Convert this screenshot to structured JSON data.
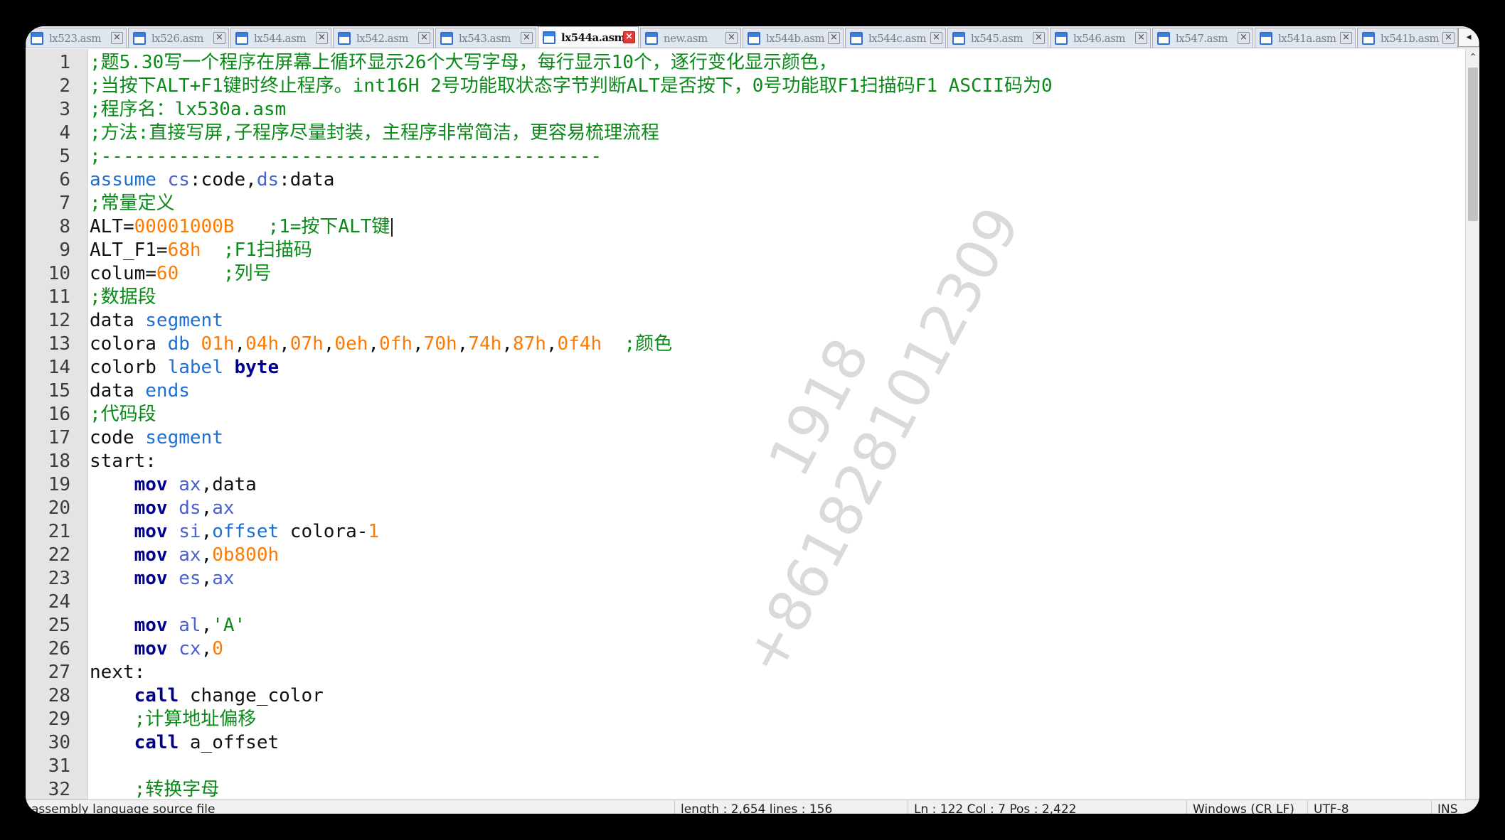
{
  "tabs": [
    {
      "label": "lx523.asm"
    },
    {
      "label": "lx526.asm"
    },
    {
      "label": "lx544.asm"
    },
    {
      "label": "lx542.asm"
    },
    {
      "label": "lx543.asm"
    },
    {
      "label": "lx544a.asm",
      "active": true
    },
    {
      "label": "new.asm"
    },
    {
      "label": "lx544b.asm"
    },
    {
      "label": "lx544c.asm"
    },
    {
      "label": "lx545.asm"
    },
    {
      "label": "lx546.asm"
    },
    {
      "label": "lx547.asm"
    },
    {
      "label": "lx541a.asm"
    },
    {
      "label": "lx541b.asm"
    }
  ],
  "tab_close_glyph": "×",
  "tab_nav_glyph": "◂",
  "code_lines": [
    {
      "n": "1",
      "tokens": [
        {
          "c": "c",
          "t": ";题5.30写一个程序在屏幕上循环显示26个大写字母，每行显示10个，逐行变化显示颜色，"
        }
      ]
    },
    {
      "n": "2",
      "tokens": [
        {
          "c": "c",
          "t": ";当按下ALT+F1键时终止程序。int16H 2号功能取状态字节判断ALT是否按下，0号功能取F1扫描码F1 ASCII码为0"
        }
      ]
    },
    {
      "n": "3",
      "tokens": [
        {
          "c": "c",
          "t": ";程序名：lx530a.asm"
        }
      ]
    },
    {
      "n": "4",
      "tokens": [
        {
          "c": "c",
          "t": ";方法:直接写屏,子程序尽量封装，主程序非常简洁，更容易梳理流程"
        }
      ]
    },
    {
      "n": "5",
      "tokens": [
        {
          "c": "c",
          "t": ";---------------------------------------------"
        }
      ]
    },
    {
      "n": "6",
      "tokens": [
        {
          "c": "k",
          "t": "assume "
        },
        {
          "c": "r",
          "t": "cs"
        },
        {
          "c": "t",
          "t": ":code,"
        },
        {
          "c": "r",
          "t": "ds"
        },
        {
          "c": "t",
          "t": ":data"
        }
      ]
    },
    {
      "n": "7",
      "tokens": [
        {
          "c": "c",
          "t": ";常量定义"
        }
      ]
    },
    {
      "n": "8",
      "tokens": [
        {
          "c": "t",
          "t": "ALT="
        },
        {
          "c": "o",
          "t": "00001000B"
        },
        {
          "c": "c",
          "t": "   ;1=按下ALT键"
        }
      ],
      "caret": true
    },
    {
      "n": "9",
      "tokens": [
        {
          "c": "t",
          "t": "ALT_F1="
        },
        {
          "c": "o",
          "t": "68h"
        },
        {
          "c": "c",
          "t": "  ;F1扫描码"
        }
      ]
    },
    {
      "n": "10",
      "tokens": [
        {
          "c": "t",
          "t": "colum="
        },
        {
          "c": "o",
          "t": "60"
        },
        {
          "c": "c",
          "t": "    ;列号"
        }
      ]
    },
    {
      "n": "11",
      "tokens": [
        {
          "c": "c",
          "t": ";数据段"
        }
      ]
    },
    {
      "n": "12",
      "tokens": [
        {
          "c": "t",
          "t": "data "
        },
        {
          "c": "k",
          "t": "segment"
        }
      ]
    },
    {
      "n": "13",
      "tokens": [
        {
          "c": "t",
          "t": "colora "
        },
        {
          "c": "k",
          "t": "db "
        },
        {
          "c": "o",
          "t": "01h"
        },
        {
          "c": "t",
          "t": ","
        },
        {
          "c": "o",
          "t": "04h"
        },
        {
          "c": "t",
          "t": ","
        },
        {
          "c": "o",
          "t": "07h"
        },
        {
          "c": "t",
          "t": ","
        },
        {
          "c": "o",
          "t": "0eh"
        },
        {
          "c": "t",
          "t": ","
        },
        {
          "c": "o",
          "t": "0fh"
        },
        {
          "c": "t",
          "t": ","
        },
        {
          "c": "o",
          "t": "70h"
        },
        {
          "c": "t",
          "t": ","
        },
        {
          "c": "o",
          "t": "74h"
        },
        {
          "c": "t",
          "t": ","
        },
        {
          "c": "o",
          "t": "87h"
        },
        {
          "c": "t",
          "t": ","
        },
        {
          "c": "o",
          "t": "0f4h"
        },
        {
          "c": "c",
          "t": "  ;颜色"
        }
      ]
    },
    {
      "n": "14",
      "tokens": [
        {
          "c": "t",
          "t": "colorb "
        },
        {
          "c": "k",
          "t": "label "
        },
        {
          "c": "b",
          "t": "byte"
        }
      ]
    },
    {
      "n": "15",
      "tokens": [
        {
          "c": "t",
          "t": "data "
        },
        {
          "c": "k",
          "t": "ends"
        }
      ]
    },
    {
      "n": "16",
      "tokens": [
        {
          "c": "c",
          "t": ";代码段"
        }
      ]
    },
    {
      "n": "17",
      "tokens": [
        {
          "c": "t",
          "t": "code "
        },
        {
          "c": "k",
          "t": "segment"
        }
      ]
    },
    {
      "n": "18",
      "tokens": [
        {
          "c": "t",
          "t": "start:"
        }
      ]
    },
    {
      "n": "19",
      "tokens": [
        {
          "c": "t",
          "t": "    "
        },
        {
          "c": "b",
          "t": "mov "
        },
        {
          "c": "r",
          "t": "ax"
        },
        {
          "c": "t",
          "t": ",data"
        }
      ]
    },
    {
      "n": "20",
      "tokens": [
        {
          "c": "t",
          "t": "    "
        },
        {
          "c": "b",
          "t": "mov "
        },
        {
          "c": "r",
          "t": "ds"
        },
        {
          "c": "t",
          "t": ","
        },
        {
          "c": "r",
          "t": "ax"
        }
      ]
    },
    {
      "n": "21",
      "tokens": [
        {
          "c": "t",
          "t": "    "
        },
        {
          "c": "b",
          "t": "mov "
        },
        {
          "c": "r",
          "t": "si"
        },
        {
          "c": "t",
          "t": ","
        },
        {
          "c": "k",
          "t": "offset "
        },
        {
          "c": "t",
          "t": "colora-"
        },
        {
          "c": "o",
          "t": "1"
        }
      ]
    },
    {
      "n": "22",
      "tokens": [
        {
          "c": "t",
          "t": "    "
        },
        {
          "c": "b",
          "t": "mov "
        },
        {
          "c": "r",
          "t": "ax"
        },
        {
          "c": "t",
          "t": ","
        },
        {
          "c": "o",
          "t": "0b800h"
        }
      ]
    },
    {
      "n": "23",
      "tokens": [
        {
          "c": "t",
          "t": "    "
        },
        {
          "c": "b",
          "t": "mov "
        },
        {
          "c": "r",
          "t": "es"
        },
        {
          "c": "t",
          "t": ","
        },
        {
          "c": "r",
          "t": "ax"
        }
      ]
    },
    {
      "n": "24",
      "tokens": []
    },
    {
      "n": "25",
      "tokens": [
        {
          "c": "t",
          "t": "    "
        },
        {
          "c": "b",
          "t": "mov "
        },
        {
          "c": "r",
          "t": "al"
        },
        {
          "c": "t",
          "t": ","
        },
        {
          "c": "c",
          "t": "'A'"
        }
      ]
    },
    {
      "n": "26",
      "tokens": [
        {
          "c": "t",
          "t": "    "
        },
        {
          "c": "b",
          "t": "mov "
        },
        {
          "c": "r",
          "t": "cx"
        },
        {
          "c": "t",
          "t": ","
        },
        {
          "c": "o",
          "t": "0"
        }
      ]
    },
    {
      "n": "27",
      "tokens": [
        {
          "c": "t",
          "t": "next:"
        }
      ]
    },
    {
      "n": "28",
      "tokens": [
        {
          "c": "t",
          "t": "    "
        },
        {
          "c": "b",
          "t": "call "
        },
        {
          "c": "t",
          "t": "change_color"
        }
      ]
    },
    {
      "n": "29",
      "tokens": [
        {
          "c": "t",
          "t": "    "
        },
        {
          "c": "c",
          "t": ";计算地址偏移"
        }
      ]
    },
    {
      "n": "30",
      "tokens": [
        {
          "c": "t",
          "t": "    "
        },
        {
          "c": "b",
          "t": "call "
        },
        {
          "c": "t",
          "t": "a_offset"
        }
      ]
    },
    {
      "n": "31",
      "tokens": []
    },
    {
      "n": "32",
      "tokens": [
        {
          "c": "t",
          "t": "    "
        },
        {
          "c": "c",
          "t": ";转换字母"
        }
      ]
    }
  ],
  "scrollbar": {
    "up_glyph": "⌃",
    "down_glyph": "⌄"
  },
  "status": {
    "file_type": "assembly language source file",
    "length_info": "length : 2,654    lines : 156",
    "position_info": "Ln : 122    Col : 7    Pos : 2,422",
    "eol": "Windows (CR LF)",
    "encoding": "UTF-8",
    "mode": "INS"
  },
  "watermark": {
    "line1": "1918",
    "line2": "+8618281012309"
  },
  "colors": {
    "comment": "#0a8a18",
    "keyword": "#1e6fd2",
    "number": "#ff7a00",
    "instruction": "#00008b",
    "register": "#4a5fd0"
  }
}
